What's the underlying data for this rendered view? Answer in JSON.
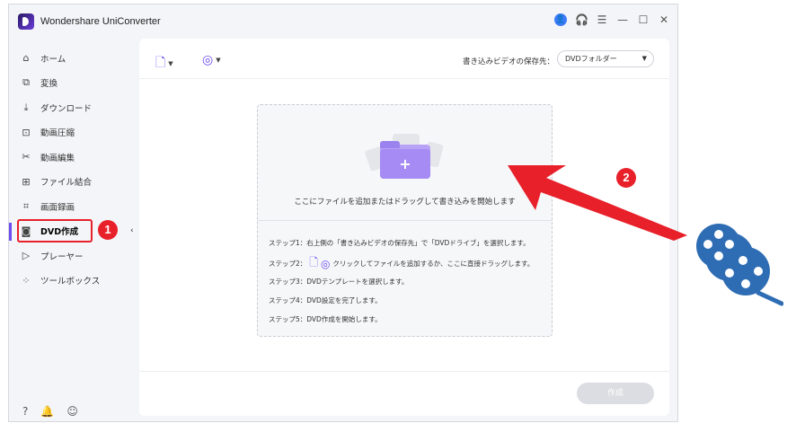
{
  "app": {
    "title": "Wondershare UniConverter"
  },
  "sidebar": {
    "items": [
      {
        "label": "ホーム",
        "icon": "home-icon"
      },
      {
        "label": "変換",
        "icon": "convert-icon"
      },
      {
        "label": "ダウンロード",
        "icon": "download-icon"
      },
      {
        "label": "動画圧縮",
        "icon": "compress-icon"
      },
      {
        "label": "動画編集",
        "icon": "scissors-icon"
      },
      {
        "label": "ファイル結合",
        "icon": "merge-icon"
      },
      {
        "label": "画面録画",
        "icon": "screen-record-icon"
      },
      {
        "label": "DVD作成",
        "icon": "dvd-icon"
      },
      {
        "label": "プレーヤー",
        "icon": "player-icon"
      },
      {
        "label": "ツールボックス",
        "icon": "toolbox-icon"
      }
    ],
    "active_index": 7
  },
  "toolbar": {
    "destination_label": "書き込みビデオの保存先：",
    "destination_value": "DVDフォルダー"
  },
  "drop_zone": {
    "main_text": "ここにファイルを追加またはドラッグして書き込みを開始します",
    "step1": "ステップ1：右上側の「書き込みビデオの保存先」で「DVDドライブ」を選択します。",
    "step2_prefix": "ステップ2：",
    "step2_suffix": "クリックしてファイルを追加するか、ここに直接ドラッグします。",
    "step3": "ステップ3：DVDテンプレートを選択します。",
    "step4": "ステップ4：DVD設定を完了します。",
    "step5": "ステップ5：DVD作成を開始します。"
  },
  "create_button": "作成",
  "annotations": {
    "badge1": "1",
    "badge2": "2",
    "color": "#e8202a"
  },
  "colors": {
    "accent": "#6c4cf0",
    "reel": "#2e6db4"
  }
}
